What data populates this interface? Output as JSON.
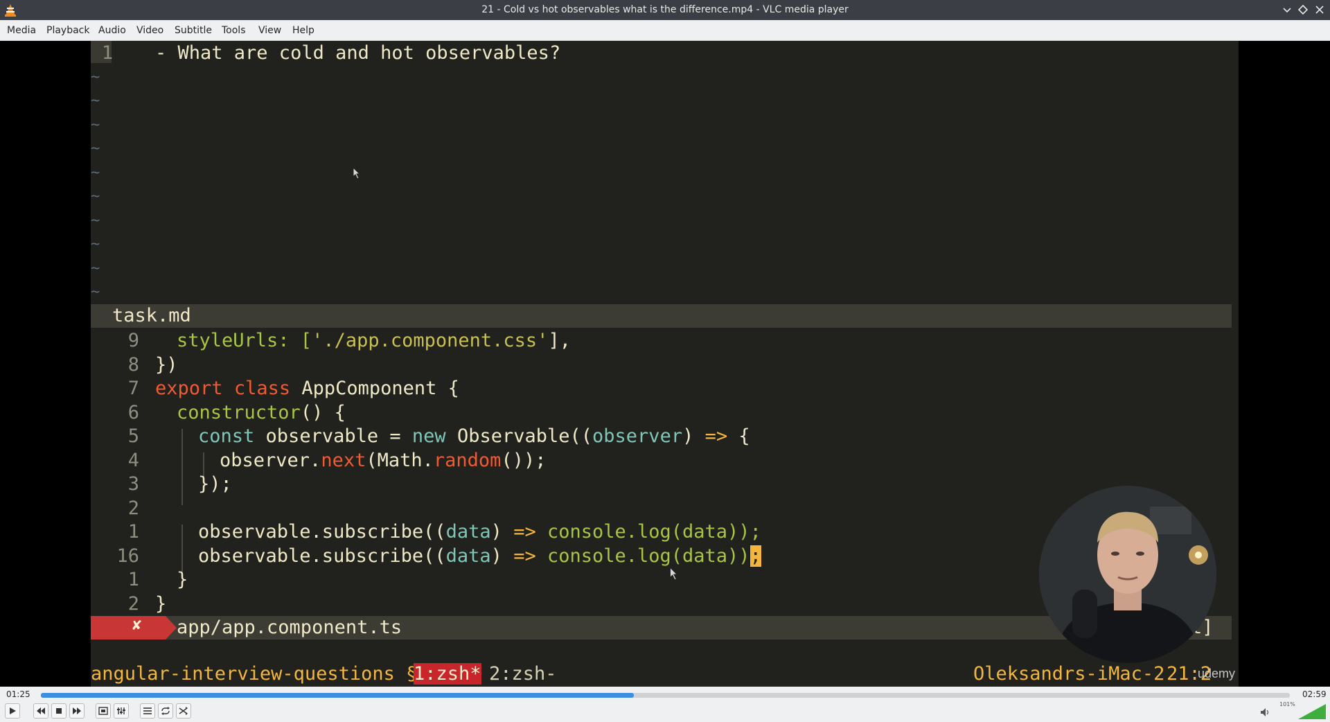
{
  "window": {
    "title": "21 - Cold vs hot observables what is the difference.mp4 - VLC media player"
  },
  "menu": [
    "Media",
    "Playback",
    "Audio",
    "Video",
    "Subtitle",
    "Tools",
    "View",
    "Help"
  ],
  "editor": {
    "top_pane": {
      "line_number": "1",
      "text": "- What are cold and hot observables?",
      "filename": "task.md"
    },
    "bottom_pane": {
      "line_numbers": [
        "9",
        "8",
        "7",
        "6",
        "5",
        "4",
        "3",
        "2",
        "1",
        "16",
        "1",
        "2"
      ],
      "lines": {
        "l9_a": "styleUrls: [",
        "l9_b": "'./app.component.css'",
        "l9_c": "],",
        "l8": "})",
        "l7_kw1": "export",
        "l7_kw2": "class",
        "l7_name": "AppComponent {",
        "l6_fn": "constructor",
        "l6_rest": "() {",
        "l5_const": "const",
        "l5_name": "observable",
        "l5_eq": "=",
        "l5_new": "new",
        "l5_obs": "Observable((",
        "l5_param": "observer",
        "l5_close": ")",
        "l5_arrow": "=>",
        "l5_brace": "{",
        "l4_obj": "observer.",
        "l4_next": "next",
        "l4_math": "(Math.",
        "l4_random": "random",
        "l4_end": "());",
        "l3": "});",
        "l1_a": "observable.subscribe((",
        "l1_param": "data",
        "l1_b": ")",
        "l1_arrow": "=>",
        "l1_c": "console.log(data));",
        "l16_a": "observable.subscribe((",
        "l16_param": "data",
        "l16_b": ")",
        "l16_arrow": "=>",
        "l16_c": "console.log(data))",
        "l16_cursor": ";",
        "b1": "}",
        "b2": "}"
      },
      "error_mark": "✘",
      "filename": "app/app.component.ts",
      "right_fragment": "t]"
    },
    "tmux": {
      "session": "angular-interview-questions §",
      "window_active": "1:zsh*",
      "window_other": "2:zsh-",
      "host": "Oleksandrs-iMac-2",
      "clock": "21:2"
    },
    "watermark": "udemy"
  },
  "player": {
    "elapsed": "01:25",
    "total": "02:59",
    "progress": 0.475,
    "volume_label": "101%",
    "volume": 1.01
  },
  "colors": {
    "accent": "#3d8ee0",
    "editor_bg": "#21221d",
    "error": "#c93636"
  }
}
